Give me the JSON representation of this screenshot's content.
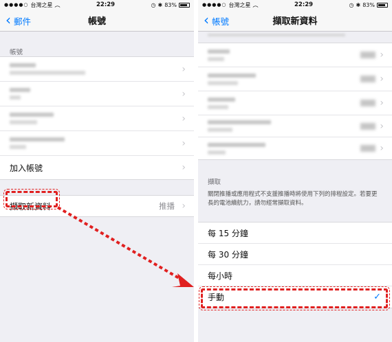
{
  "status": {
    "carrier": "台灣之星",
    "time": "22:29",
    "battery": "83%"
  },
  "left": {
    "back_label": "郵件",
    "title": "帳號",
    "accounts_header": "帳號",
    "add_account": "加入帳號",
    "fetch_label": "擷取新資料",
    "fetch_value": "推播"
  },
  "right": {
    "back_label": "帳號",
    "title": "擷取新資料",
    "fetch_header": "擷取",
    "fetch_desc": "關閉推播或應用程式不支援推播時將使用下列的排程設定。若要更長的電池續航力，請勿經常擷取資料。",
    "options": [
      "每 15 分鐘",
      "每 30 分鐘",
      "每小時",
      "手動"
    ],
    "selected_option": "手動"
  },
  "colors": {
    "accent": "#007aff",
    "annotation": "#e02020"
  }
}
